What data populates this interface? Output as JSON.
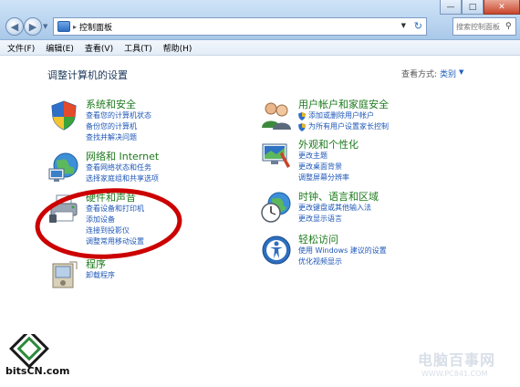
{
  "window": {
    "address_path": "控制面板",
    "search_placeholder": "搜索控制面板",
    "min_glyph": "—",
    "max_glyph": "□",
    "close_glyph": "✕"
  },
  "menu": [
    "文件(F)",
    "编辑(E)",
    "查看(V)",
    "工具(T)",
    "帮助(H)"
  ],
  "page": {
    "title": "调整计算机的设置",
    "view_by_label": "查看方式:",
    "view_by_value": "类别"
  },
  "categories_left": [
    {
      "title": "系统和安全",
      "icon": "shield-icon",
      "links": [
        "查看您的计算机状态",
        "备份您的计算机",
        "查找并解决问题"
      ]
    },
    {
      "title": "网络和 Internet",
      "icon": "network-icon",
      "links": [
        "查看网络状态和任务",
        "选择家庭组和共享选项"
      ]
    },
    {
      "title": "硬件和声音",
      "icon": "printer-icon",
      "links": [
        "查看设备和打印机",
        "添加设备",
        "连接到投影仪",
        "调整常用移动设置"
      ]
    },
    {
      "title": "程序",
      "icon": "programs-icon",
      "links": [
        "卸载程序"
      ]
    }
  ],
  "categories_right": [
    {
      "title": "用户帐户和家庭安全",
      "icon": "users-icon",
      "links": [
        "添加或删除用户帐户",
        "为所有用户设置家长控制"
      ]
    },
    {
      "title": "外观和个性化",
      "icon": "appearance-icon",
      "links": [
        "更改主题",
        "更改桌面背景",
        "调整屏幕分辨率"
      ]
    },
    {
      "title": "时钟、语言和区域",
      "icon": "clock-globe-icon",
      "links": [
        "更改键盘或其他输入法",
        "更改显示语言"
      ]
    },
    {
      "title": "轻松访问",
      "icon": "accessibility-icon",
      "links": [
        "使用 Windows 建议的设置",
        "优化视频显示"
      ]
    }
  ],
  "watermarks": {
    "left": "bitsCN.com",
    "right_title": "电脑百事网",
    "right_url": "WWW.PC841.COM"
  },
  "colors": {
    "category_title": "#1d7a1d",
    "link": "#1e57b8",
    "highlight_ellipse": "#cc0000"
  }
}
